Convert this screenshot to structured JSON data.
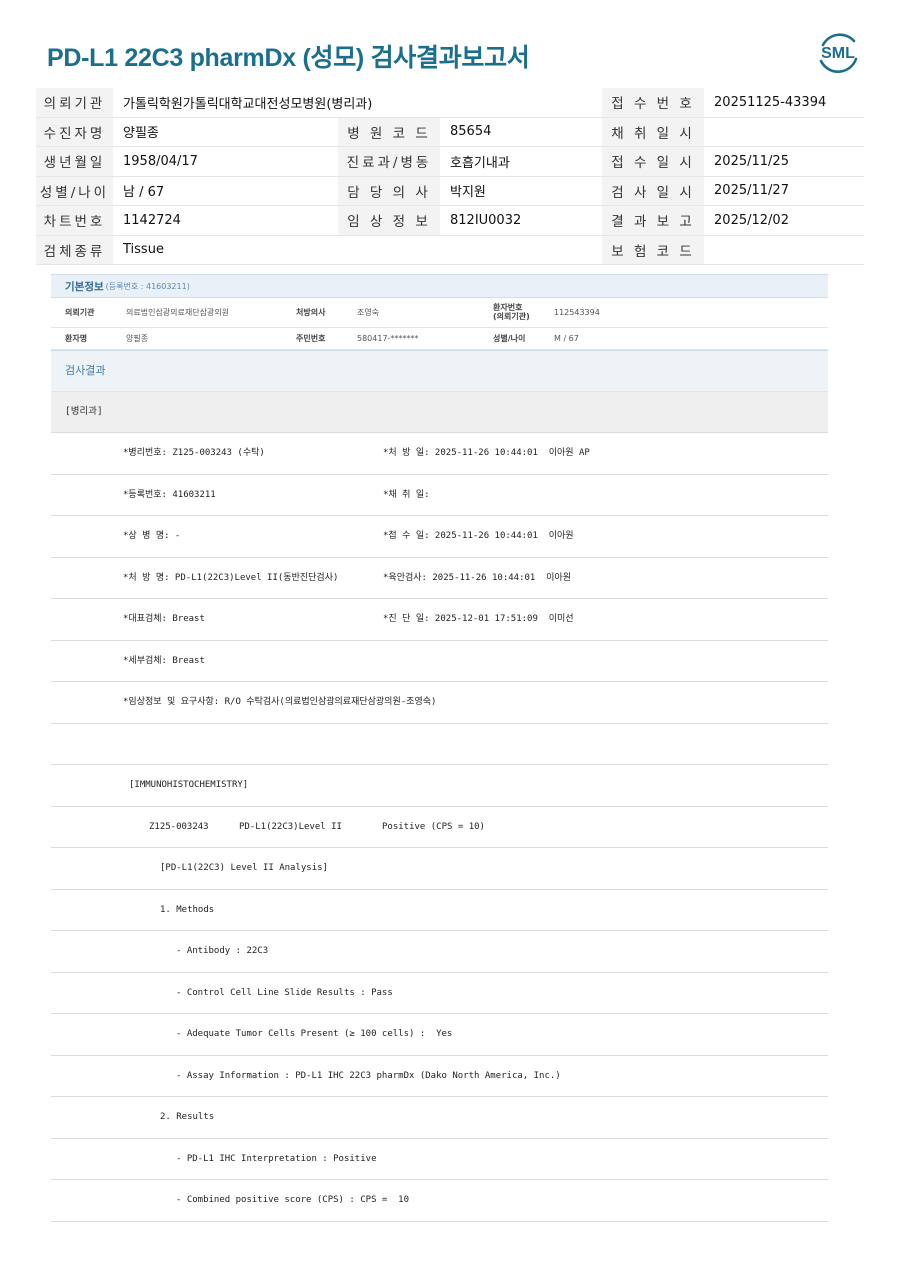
{
  "document_title": "PD-L1 22C3 pharmDx (성모) 검사결과보고서",
  "logo_text": "SML",
  "patient_rows": [
    {
      "l1": "의뢰기관",
      "v1": "가톨릭학원가톨릭대학교대전성모병원(병리과)",
      "l2": "",
      "v2": "",
      "l3": "접 수 번 호",
      "v3": "20251125-43394"
    },
    {
      "l1": "수진자명",
      "v1": "양필종",
      "l2": "병 원 코 드",
      "v2": "85654",
      "l3": "채 취 일 시",
      "v3": ""
    },
    {
      "l1": "생년월일",
      "v1": "1958/04/17",
      "l2": "진료과/병동",
      "v2": "호흡기내과",
      "l3": "접 수 일 시",
      "v3": "2025/11/25"
    },
    {
      "l1": "성별/나이",
      "v1": "남 / 67",
      "l2": "담 당 의 사",
      "v2": "박지원",
      "l3": "검 사 일 시",
      "v3": "2025/11/27"
    },
    {
      "l1": "차트번호",
      "v1": "1142724",
      "l2": "임 상 정 보",
      "v2": "812IU0032",
      "l3": "결 과 보 고",
      "v3": "2025/12/02"
    },
    {
      "l1": "검체종류",
      "v1": "Tissue",
      "l2": "",
      "v2": "",
      "l3": "보 험 코 드",
      "v3": ""
    }
  ],
  "basic_info": {
    "title": "기본정보",
    "sub": "(등록번호 : 41603211)",
    "row1": {
      "k1": "의뢰기관",
      "v1": "의료법인삼광의료재단삼광의원",
      "k2": "처방의사",
      "v2": "조영숙",
      "k3a": "환자번호",
      "k3b": "(의뢰기관)",
      "v3": "112543394"
    },
    "row2": {
      "k1": "환자명",
      "v1": "양필종",
      "k2": "주민번호",
      "v2": "580417-*******",
      "k3": "성별/나이",
      "v3": "M / 67"
    }
  },
  "result_header": "검사결과",
  "dept_header": "[병리과]",
  "fields": [
    {
      "a": "*병리번호: Z125-003243 (수탁)",
      "b": "*처 방 일: 2025-11-26 10:44:01  이아원 AP"
    },
    {
      "a": "*등록번호: 41603211",
      "b": "*채 취 일:"
    },
    {
      "a": "*상 병 명: -",
      "b": "*접 수 일: 2025-11-26 10:44:01  이아원"
    },
    {
      "a": "*처 방 명: PD-L1(22C3)Level II(동반진단검사)",
      "b": "*육안검사: 2025-11-26 10:44:01  이아원"
    },
    {
      "a": "*대표검체: Breast",
      "b": "*진 단 일: 2025-12-01 17:51:09  이미선"
    },
    {
      "a": "*세부검체: Breast",
      "b": ""
    },
    {
      "a": "*임상정보 및 요구사항: R/O 수탁검사(의료법인삼광의료재단삼광의원-조영숙)",
      "b": ""
    }
  ],
  "report_lines": {
    "ihc_header": "[IMMUNOHISTOCHEMISTRY]",
    "summary_id": "Z125-003243",
    "summary_test": "PD-L1(22C3)Level II",
    "summary_result": "Positive (CPS = 10)",
    "analysis_header": "[PD-L1(22C3) Level II Analysis]",
    "methods": "1. Methods",
    "antibody": "- Antibody : 22C3",
    "control": "- Control Cell Line Slide Results : Pass",
    "adequate": "- Adequate Tumor Cells Present (≥ 100 cells) :  Yes",
    "assay": "- Assay Information : PD-L1 IHC 22C3 pharmDx (Dako North America, Inc.)",
    "results": "2. Results",
    "interpretation": "- PD-L1 IHC Interpretation : Positive",
    "cps": "- Combined positive score (CPS) : CPS =  10"
  },
  "colors": {
    "title": "#1b6f8e",
    "logo": "#1b6f8e",
    "label_bg": "#f3f3f3",
    "section_bg": "#eef3f8"
  }
}
